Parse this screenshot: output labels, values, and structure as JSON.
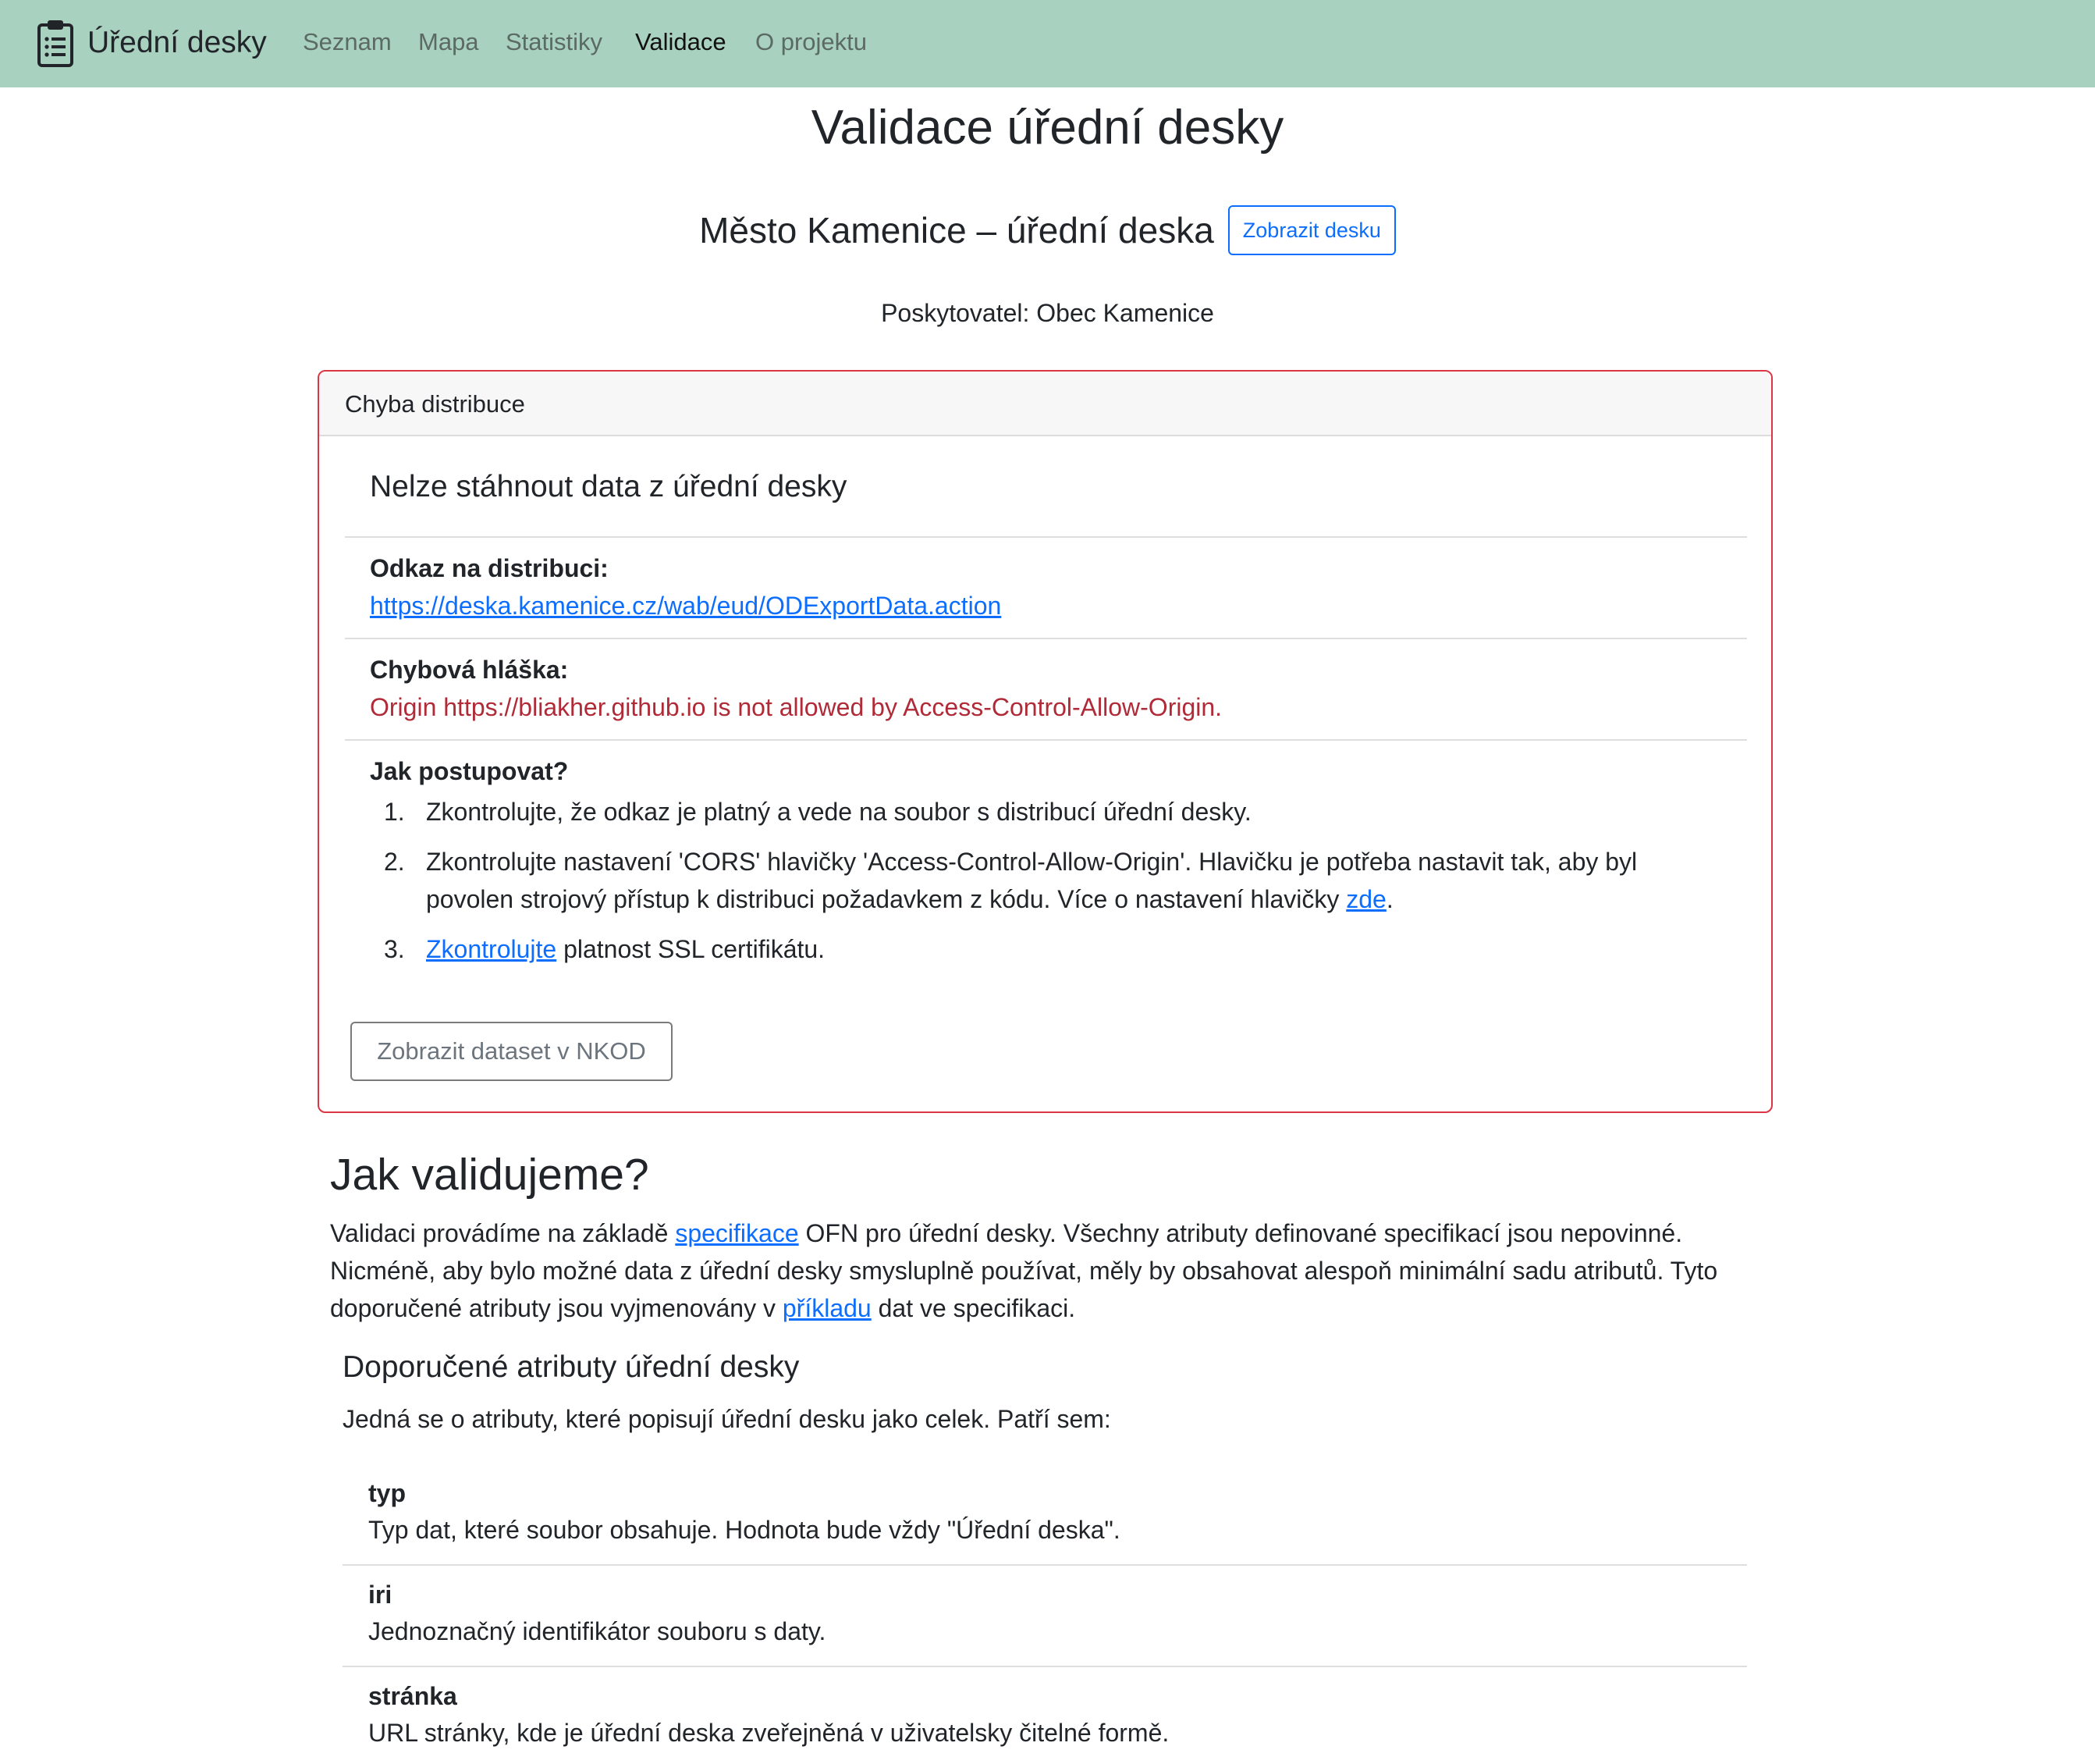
{
  "navbar": {
    "brand": "Úřední desky",
    "items": [
      "Seznam",
      "Mapa",
      "Statistiky",
      "Validace",
      "O projektu"
    ],
    "active": "Validace",
    "bg_color": "#a9d1bf"
  },
  "page": {
    "title": "Validace úřední desky",
    "desk_title": "Město Kamenice – úřední deska",
    "show_desk_button": "Zobrazit desku",
    "provider": "Poskytovatel: Obec Kamenice"
  },
  "error_card": {
    "header": "Chyba distribuce",
    "title": "Nelze stáhnout data z úřední desky",
    "link_label": "Odkaz na distribuci:",
    "link_url": "https://deska.kamenice.cz/wab/eud/ODExportData.action",
    "error_label": "Chybová hláška:",
    "error_message": "Origin https://bliakher.github.io is not allowed by Access-Control-Allow-Origin.",
    "steps_label": "Jak postupovat?",
    "steps": {
      "s1": "Zkontrolujte, že odkaz je platný a vede na soubor s distribucí úřední desky.",
      "s2_text": "Zkontrolujte nastavení 'CORS' hlavičky 'Access-Control-Allow-Origin'. Hlavičku je potřeba nastavit tak, aby byl povolen strojový přístup k distribuci požadavkem z kódu. Více o nastavení hlavičky",
      "s2_link": "zde",
      "s3_link": "Zkontrolujte",
      "s3_text": "platnost SSL certifikátu."
    },
    "nkod_button": "Zobrazit dataset v NKOD",
    "border_color": "#dc3545"
  },
  "validation": {
    "heading": "Jak validujeme?",
    "p_part1": "Validaci provádíme na základě",
    "p_link1": "specifikace",
    "p_part2": "OFN pro úřední desky. Všechny atributy definované specifikací jsou nepovinné. Nicméně, aby bylo možné data z úřední desky smysluplně používat, měly by obsahovat alespoň minimální sadu atributů. Tyto doporučené atributy jsou vyjmenovány v",
    "p_link2": "příkladu",
    "p_part3": "dat ve specifikaci.",
    "sub_heading": "Doporučené atributy úřední desky",
    "intro": "Jedná se o atributy, které popisují úřední desku jako celek. Patří sem:",
    "attributes": [
      {
        "name": "typ",
        "desc": "Typ dat, které soubor obsahuje. Hodnota bude vždy \"Úřední deska\"."
      },
      {
        "name": "iri",
        "desc": "Jednoznačný identifikátor souboru s daty."
      },
      {
        "name": "stránka",
        "desc": "URL stránky, kde je úřední deska zveřejněná v uživatelsky čitelné formě."
      }
    ]
  }
}
